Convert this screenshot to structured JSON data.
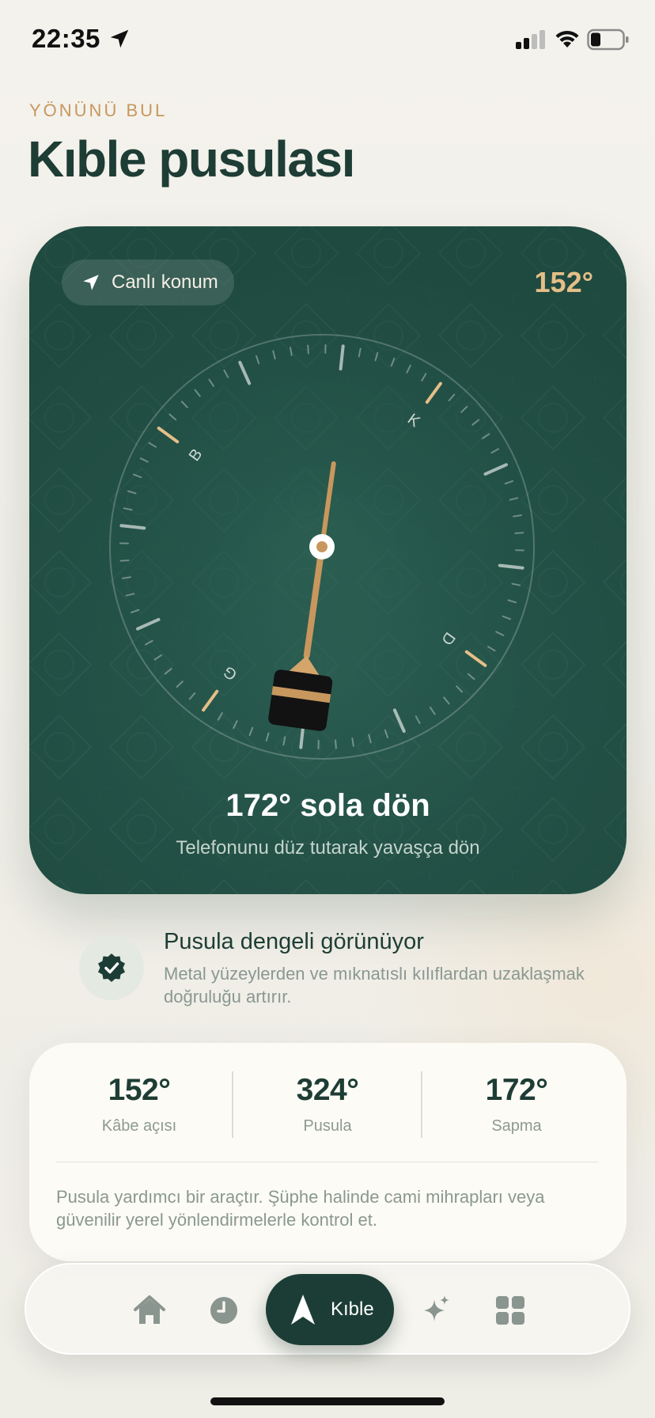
{
  "status_bar": {
    "time": "22:35",
    "icons": [
      "location-arrow-icon",
      "signal-icon",
      "wifi-icon",
      "battery-icon"
    ]
  },
  "header": {
    "eyebrow": "YÖNÜNÜ BUL",
    "title": "Kıble pusulası"
  },
  "compass": {
    "live_location_label": "Canlı konum",
    "heading_value": "152°",
    "cardinals": {
      "north": "K",
      "east": "D",
      "south": "G",
      "west": "B"
    },
    "compass_heading_deg": 324,
    "qibla_bearing_deg": 152,
    "turn_instruction": "172° sola dön",
    "turn_hint": "Telefonunu düz tutarak yavaşça dön"
  },
  "notice": {
    "title": "Pusula dengeli görünüyor",
    "text": "Metal yüzeylerden ve mıknatıslı kılıflardan uzaklaşmak doğruluğu artırır."
  },
  "stats": {
    "items": [
      {
        "value": "152°",
        "label": "Kâbe açısı"
      },
      {
        "value": "324°",
        "label": "Pusula"
      },
      {
        "value": "172°",
        "label": "Sapma"
      }
    ],
    "note": "Pusula yardımcı bir araçtır. Şüphe halinde cami mihrapları veya güvenilir yerel yönlendirmelerle kontrol et."
  },
  "tab_bar": {
    "items": [
      {
        "icon": "home-icon"
      },
      {
        "icon": "clock-icon"
      },
      {
        "icon": "compass-arrow-icon",
        "label": "Kıble",
        "active": true
      },
      {
        "icon": "sparkles-icon"
      },
      {
        "icon": "grid-icon"
      }
    ]
  },
  "colors": {
    "card_green": "#245247",
    "accent_gold": "#c8975e",
    "title_dark": "#1d3d35"
  }
}
